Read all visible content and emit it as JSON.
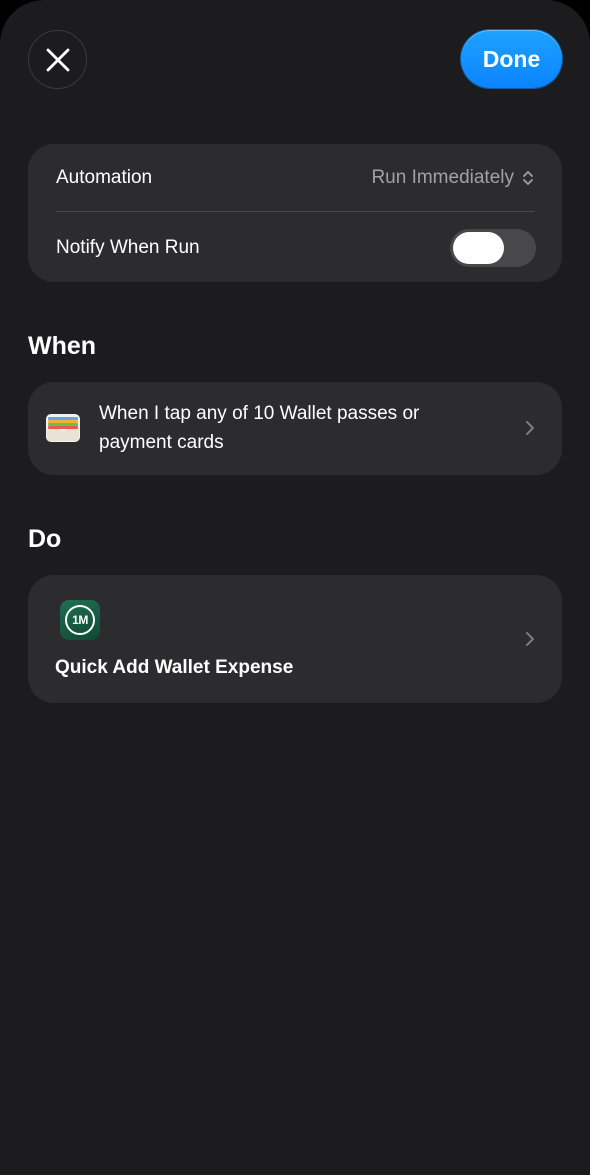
{
  "header": {
    "close_icon": "xmark-icon",
    "done_label": "Done",
    "accent_color": "#0a84ff"
  },
  "settings": {
    "automation_label": "Automation",
    "automation_value": "Run Immediately",
    "automation_value_icon": "chevron-up-down-icon",
    "notify_label": "Notify When Run",
    "notify_enabled": false
  },
  "when_section": {
    "title": "When",
    "trigger_icon": "wallet-icon",
    "trigger_text": "When I tap any of 10 Wallet passes or payment cards"
  },
  "do_section": {
    "title": "Do",
    "app_icon": "1money-app-icon",
    "app_icon_text": "1M",
    "action_label": "Quick Add Wallet Expense"
  },
  "colors": {
    "background": "#1c1c1e",
    "card": "#2c2c2e",
    "secondary_text": "#a1a1a6"
  }
}
